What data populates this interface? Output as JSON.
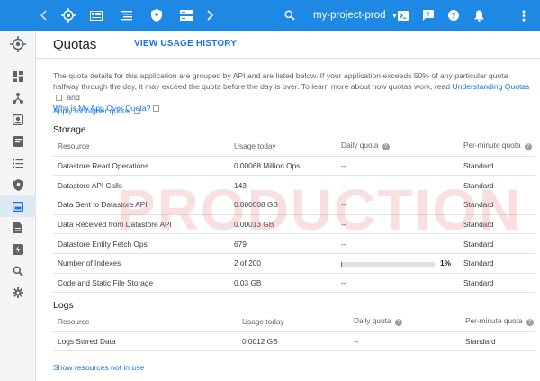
{
  "topbar": {
    "project_name": "my-project-prod",
    "accent": "#1e88e5",
    "icons": [
      "back-icon",
      "app-logo-icon",
      "dashboard-icon",
      "list-icon",
      "security-icon",
      "storage-icon",
      "forward-icon",
      "search-icon",
      "dropdown-icon",
      "cloud-shell-icon",
      "feedback-icon",
      "help-icon",
      "notifications-icon",
      "more-icon"
    ]
  },
  "rail": {
    "items": [
      "dashboard-icon",
      "topology-icon",
      "versions-icon",
      "instances-icon",
      "task-queues-icon",
      "security-scan-icon",
      "quotas-icon",
      "blobstore-icon",
      "memcache-icon",
      "search-icon",
      "settings-icon"
    ],
    "active_index": 6
  },
  "header": {
    "title": "Quotas",
    "usage_history_link": "VIEW USAGE HISTORY"
  },
  "intro": {
    "text_1": "The quota details for this application are grouped by API and are listed below. If your application exceeds 50% of any particular quota halfway through the day, it may exceed the quota before the day is over. To learn more about how quotas work, read ",
    "link_1": "Understanding Quotas",
    "text_2": " and",
    "link_2": "Why is My App Over Quota?",
    "apply_link": "Apply for higher quota"
  },
  "storage": {
    "title": "Storage",
    "columns": [
      "Resource",
      "Usage today",
      "Daily quota",
      "Per-minute quota"
    ],
    "rows": [
      {
        "resource": "Datastore Read Operations",
        "usage": "0.00068 Million Ops",
        "daily": "--",
        "per_minute": "Standard"
      },
      {
        "resource": "Datastore API Calls",
        "usage": "143",
        "daily": "--",
        "per_minute": "Standard"
      },
      {
        "resource": "Data Sent to Datastore API",
        "usage": "0.000008 GB",
        "daily": "--",
        "per_minute": "Standard"
      },
      {
        "resource": "Data Received from Datastore API",
        "usage": "0.00013 GB",
        "daily": "--",
        "per_minute": "Standard"
      },
      {
        "resource": "Datastore Entity Fetch Ops",
        "usage": "679",
        "daily": "--",
        "per_minute": "Standard"
      },
      {
        "resource": "Number of Indexes",
        "usage": "2 of 200",
        "daily_percent": "1%",
        "daily_fraction": 0.01,
        "per_minute": "Standard"
      },
      {
        "resource": "Code and Static File Storage",
        "usage": "0.03 GB",
        "daily": "--",
        "per_minute": "Standard"
      }
    ]
  },
  "logs": {
    "title": "Logs",
    "columns": [
      "Resource",
      "Usage today",
      "Daily quota",
      "Per-minute quota"
    ],
    "rows": [
      {
        "resource": "Logs Stored Data",
        "usage": "0.0012 GB",
        "daily": "--",
        "per_minute": "Standard"
      }
    ]
  },
  "watermark": "PRODUCTION",
  "footer": {
    "show_resources_link": "Show resources not in use"
  }
}
